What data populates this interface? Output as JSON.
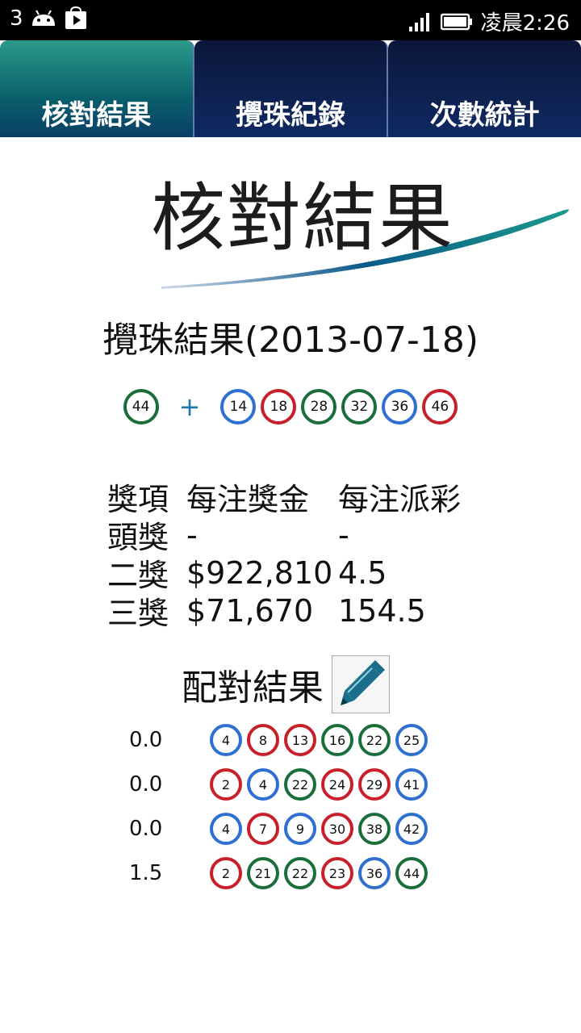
{
  "status_bar": {
    "left_number": "3",
    "time": "凌晨2:26"
  },
  "tabs": [
    {
      "label": "核對結果",
      "active": true
    },
    {
      "label": "攪珠紀錄",
      "active": false
    },
    {
      "label": "次數統計",
      "active": false
    }
  ],
  "hero": {
    "title": "核對結果"
  },
  "draw": {
    "title": "攪珠結果(2013-07-18)",
    "extra_ball": {
      "number": "44",
      "color": "green"
    },
    "plus": "+",
    "balls": [
      {
        "number": "14",
        "color": "blue"
      },
      {
        "number": "18",
        "color": "red"
      },
      {
        "number": "28",
        "color": "green"
      },
      {
        "number": "32",
        "color": "green"
      },
      {
        "number": "36",
        "color": "blue"
      },
      {
        "number": "46",
        "color": "red"
      }
    ]
  },
  "prizes": {
    "headers": [
      "獎項",
      "每注獎金",
      "每注派彩"
    ],
    "rows": [
      [
        "頭獎",
        "-",
        "-"
      ],
      [
        "二獎",
        "$922,810",
        "4.5"
      ],
      [
        "三獎",
        "$71,670",
        "154.5"
      ]
    ]
  },
  "match": {
    "title": "配對結果",
    "edit_icon": "pencil-icon",
    "rows": [
      {
        "value": "0.0",
        "balls": [
          {
            "number": "4",
            "color": "blue"
          },
          {
            "number": "8",
            "color": "red"
          },
          {
            "number": "13",
            "color": "red"
          },
          {
            "number": "16",
            "color": "green"
          },
          {
            "number": "22",
            "color": "green"
          },
          {
            "number": "25",
            "color": "blue"
          }
        ]
      },
      {
        "value": "0.0",
        "balls": [
          {
            "number": "2",
            "color": "red"
          },
          {
            "number": "4",
            "color": "blue"
          },
          {
            "number": "22",
            "color": "green"
          },
          {
            "number": "24",
            "color": "red"
          },
          {
            "number": "29",
            "color": "red"
          },
          {
            "number": "41",
            "color": "blue"
          }
        ]
      },
      {
        "value": "0.0",
        "balls": [
          {
            "number": "4",
            "color": "blue"
          },
          {
            "number": "7",
            "color": "red"
          },
          {
            "number": "9",
            "color": "blue"
          },
          {
            "number": "30",
            "color": "red"
          },
          {
            "number": "38",
            "color": "green"
          },
          {
            "number": "42",
            "color": "blue"
          }
        ]
      },
      {
        "value": "1.5",
        "balls": [
          {
            "number": "2",
            "color": "red"
          },
          {
            "number": "21",
            "color": "green"
          },
          {
            "number": "22",
            "color": "green"
          },
          {
            "number": "23",
            "color": "red"
          },
          {
            "number": "36",
            "color": "blue"
          },
          {
            "number": "44",
            "color": "green"
          }
        ]
      }
    ]
  },
  "colors": {
    "ball_green": "#1a6e3a",
    "ball_blue": "#2e6fd1",
    "ball_red": "#c8202a",
    "tab_active": "#0a5f6a",
    "tab_inactive": "#0f2a63"
  }
}
